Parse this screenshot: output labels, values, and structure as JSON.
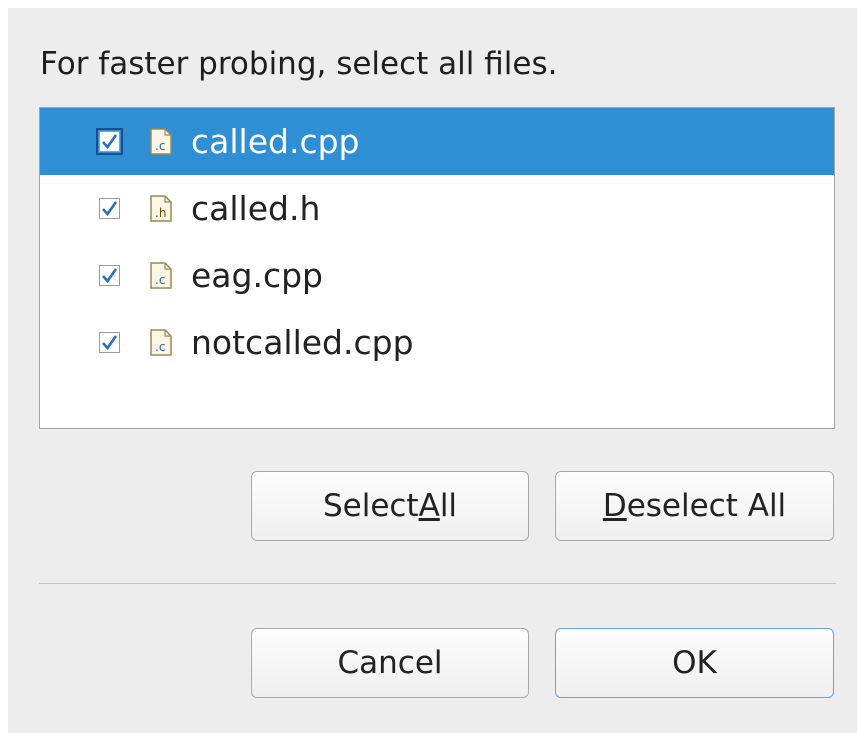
{
  "dialog": {
    "instruction": "For faster probing, select all files."
  },
  "files": [
    {
      "name": "called.cpp",
      "icon": "c-source-file-icon",
      "icon_letter": ".c",
      "checked": true,
      "selected": true
    },
    {
      "name": "called.h",
      "icon": "header-file-icon",
      "icon_letter": ".h",
      "checked": true,
      "selected": false
    },
    {
      "name": "eag.cpp",
      "icon": "c-source-file-icon",
      "icon_letter": ".c",
      "checked": true,
      "selected": false
    },
    {
      "name": "notcalled.cpp",
      "icon": "c-source-file-icon",
      "icon_letter": ".c",
      "checked": true,
      "selected": false
    }
  ],
  "buttons": {
    "select_all": {
      "pre": "Select ",
      "mnemonic": "A",
      "post": "ll"
    },
    "deselect_all": {
      "pre": "",
      "mnemonic": "D",
      "post": "eselect All"
    },
    "cancel": "Cancel",
    "ok": "OK"
  },
  "colors": {
    "selection": "#2f8fd5",
    "check": "#2a6fbf",
    "default_button_border": "#6aa3d6"
  }
}
